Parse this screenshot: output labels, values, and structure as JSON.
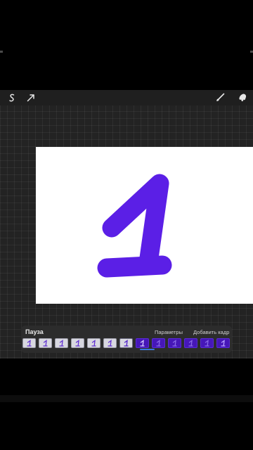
{
  "toolbar": {
    "left_tools": [
      "selection-icon",
      "transform-icon"
    ],
    "right_tools": [
      "brush-icon",
      "smudge-icon"
    ]
  },
  "canvas": {
    "drawing": "digit-one",
    "stroke_color": "#5b1fe6",
    "background": "#ffffff"
  },
  "animation": {
    "pause_label": "Пауза",
    "settings_label": "Параметры",
    "add_frame_label": "Добавить кадр",
    "frames_total": 13,
    "current_frame_index": 6,
    "frame_glyph": "1",
    "past_frame_color": "#d8d8e0",
    "future_frame_color": "#4617b8",
    "indicator_color": "#3a78e0"
  }
}
